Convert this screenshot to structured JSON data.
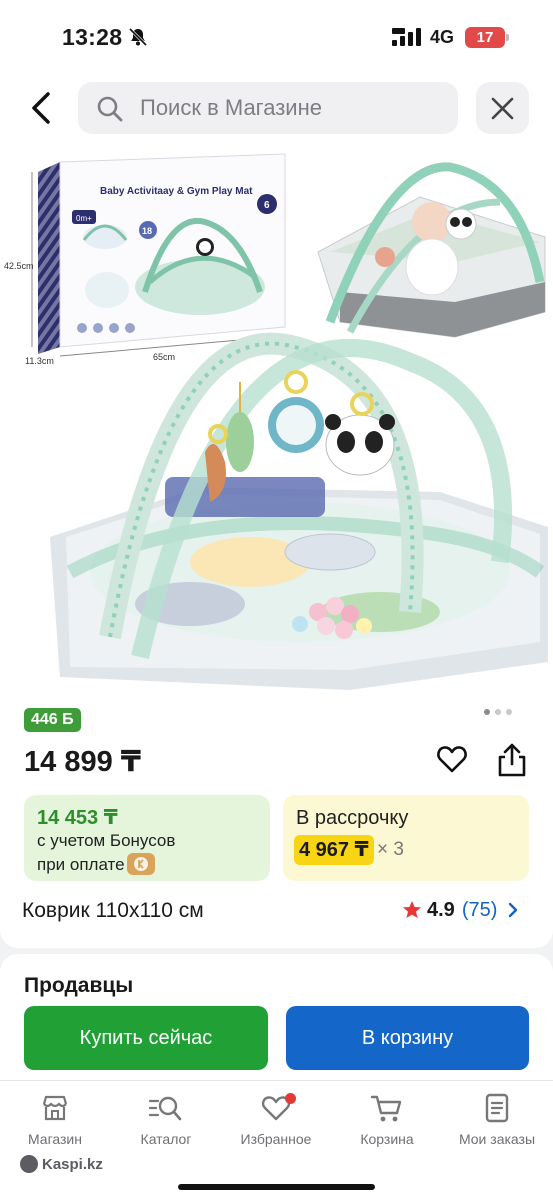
{
  "status_bar": {
    "time": "13:28",
    "network": "4G",
    "battery": "17"
  },
  "search": {
    "placeholder": "Поиск в Магазине"
  },
  "product_image": {
    "box_title": "Baby Activitaay & Gym Play Mat",
    "box_badge_age": "0m+",
    "box_badge_count": "18",
    "box_badge_months": "6",
    "dim_height": "42.5cm",
    "dim_depth": "11.3cm",
    "dim_width": "65cm"
  },
  "gallery": {
    "dots": 3,
    "active": 0
  },
  "product": {
    "bonus_badge": "446 Б",
    "price": "14 899 ₸",
    "bonus_price": "14 453 ₸",
    "bonus_line1": "с учетом Бонусов",
    "bonus_line2": "при оплате",
    "installment_title": "В рассрочку",
    "installment_amount": "4 967 ₸",
    "installment_multiplier": "× 3",
    "name": "Коврик 110х110 см",
    "rating": "4.9",
    "reviews": "(75)"
  },
  "sellers": {
    "title": "Продавцы"
  },
  "actions": {
    "buy_now": "Купить сейчас",
    "add_to_cart": "В корзину"
  },
  "tabbar": {
    "items": [
      {
        "label": "Магазин",
        "icon": "store-icon"
      },
      {
        "label": "Каталог",
        "icon": "catalog-search-icon"
      },
      {
        "label": "Избранное",
        "icon": "heart-icon"
      },
      {
        "label": "Корзина",
        "icon": "cart-icon"
      },
      {
        "label": "Мои заказы",
        "icon": "orders-icon"
      }
    ]
  },
  "brand": "Kaspi.kz",
  "colors": {
    "green": "#21a035",
    "blue": "#1466c8",
    "bonus_green_bg": "#e4f5dc",
    "installment_yellow_bg": "#fdf8d4",
    "installment_yellow": "#f7d515",
    "rating_star": "#e53935",
    "link_blue": "#1565c0"
  }
}
